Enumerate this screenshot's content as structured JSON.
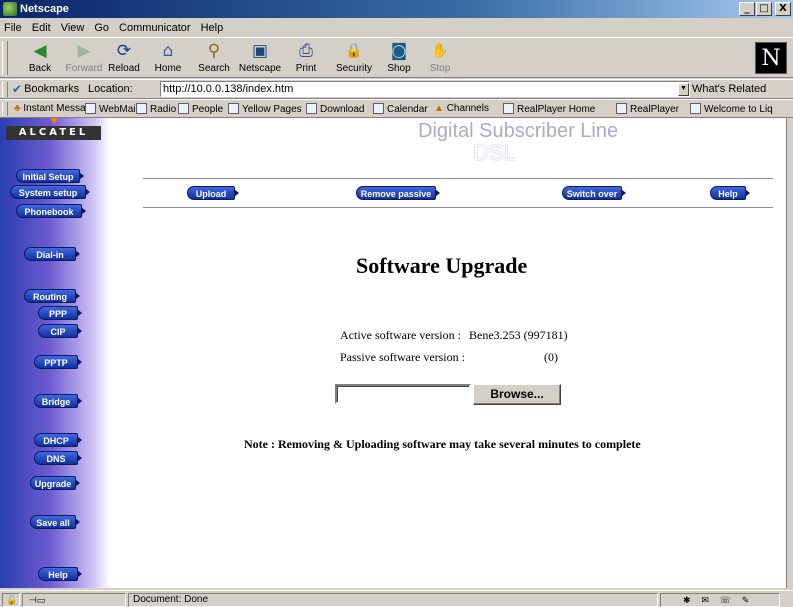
{
  "window": {
    "title": "Netscape",
    "minimize": "_",
    "maximize": "□",
    "close": "X"
  },
  "menu": [
    "File",
    "Edit",
    "View",
    "Go",
    "Communicator",
    "Help"
  ],
  "toolbar": [
    {
      "label": "Back",
      "icon": "back-arrow-icon",
      "glyph": "◀"
    },
    {
      "label": "Forward",
      "icon": "forward-arrow-icon",
      "glyph": "▶"
    },
    {
      "label": "Reload",
      "icon": "reload-icon",
      "glyph": "⟳"
    },
    {
      "label": "Home",
      "icon": "home-icon",
      "glyph": "⌂"
    },
    {
      "label": "Search",
      "icon": "search-icon",
      "glyph": "⚲"
    },
    {
      "label": "Netscape",
      "icon": "netscape-icon",
      "glyph": "▣"
    },
    {
      "label": "Print",
      "icon": "print-icon",
      "glyph": "⎙"
    },
    {
      "label": "Security",
      "icon": "lock-icon",
      "glyph": "🔒"
    },
    {
      "label": "Shop",
      "icon": "shop-icon",
      "glyph": "◙"
    },
    {
      "label": "Stop",
      "icon": "stop-icon",
      "glyph": "✋"
    }
  ],
  "netscape_logo": "N",
  "location": {
    "bookmarks_label": "Bookmarks",
    "label": "Location:",
    "url": "http://10.0.0.138/index.htm",
    "related": "What's Related"
  },
  "personal_toolbar": [
    "Instant Message",
    "WebMail",
    "Radio",
    "People",
    "Yellow Pages",
    "Download",
    "Calendar",
    "Channels",
    "RealPlayer Home",
    "RealPlayer",
    "Welcome to Liq"
  ],
  "page": {
    "logo": "ALCATEL",
    "banner_line1": "Digital Subscriber Line",
    "banner_line2": "DSL",
    "sidebar": [
      "Initial Setup",
      "System setup",
      "Phonebook",
      "Dial-in",
      "Routing",
      "PPP",
      "CIP",
      "PPTP",
      "Bridge",
      "DHCP",
      "DNS",
      "Upgrade",
      "Save all",
      "Help"
    ],
    "actions": [
      "Upload",
      "Remove passive",
      "Switch over",
      "Help"
    ],
    "title": "Software Upgrade",
    "active_label": "Active software version :",
    "active_value": "Bene3.253 (997181)",
    "passive_label": "Passive software version :",
    "passive_value": "(0)",
    "browse": "Browse...",
    "note": "Note : Removing & Uploading software may take several minutes to complete"
  },
  "status": {
    "text": "Document: Done"
  }
}
